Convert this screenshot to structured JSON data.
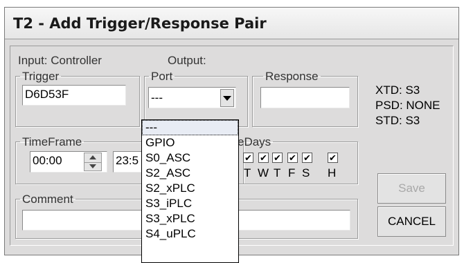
{
  "window": {
    "title": "T2 - Add Trigger/Response Pair"
  },
  "labels": {
    "input": "Input: Controller",
    "output": "Output:"
  },
  "trigger": {
    "legend": "Trigger",
    "value": "D6D53F"
  },
  "port": {
    "legend": "Port",
    "selected": "---"
  },
  "response": {
    "legend": "Response",
    "value": ""
  },
  "status": {
    "xtd": "XTD: S3",
    "psd": "PSD: NONE",
    "std": "STD: S3"
  },
  "timeframe": {
    "legend": "TimeFrame",
    "start": "00:00",
    "end_partial": "23:5"
  },
  "activedays": {
    "legend_partial": "eDays",
    "days": [
      {
        "label": "T",
        "checked": true
      },
      {
        "label": "W",
        "checked": true
      },
      {
        "label": "T",
        "checked": true
      },
      {
        "label": "F",
        "checked": true
      },
      {
        "label": "S",
        "checked": true
      },
      {
        "label": "H",
        "checked": true
      }
    ],
    "check_glyph": "✔"
  },
  "comment": {
    "legend": "Comment",
    "value": ""
  },
  "buttons": {
    "save": "Save",
    "cancel": "CANCEL"
  },
  "port_options": [
    "---",
    "GPIO",
    "S0_ASC",
    "S2_ASC",
    "S2_xPLC",
    "S3_iPLC",
    "S3_xPLC",
    "S4_uPLC"
  ]
}
